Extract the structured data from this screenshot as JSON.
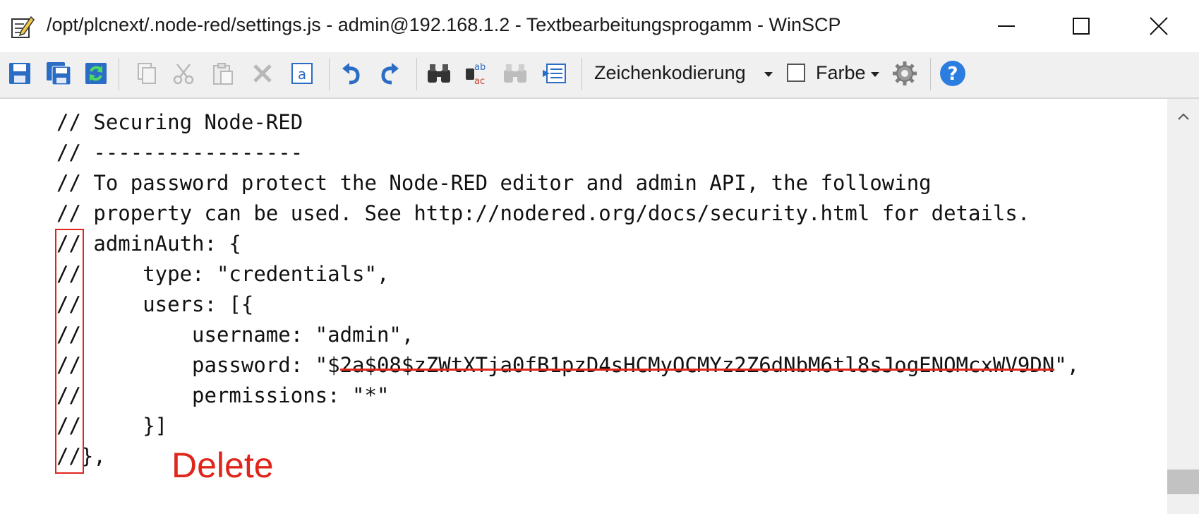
{
  "window": {
    "title": "/opt/plcnext/.node-red/settings.js - admin@192.168.1.2 - Textbearbeitungsprogamm - WinSCP"
  },
  "toolbar": {
    "encoding_label": "Zeichenkodierung",
    "color_label": "Farbe",
    "color_checked": false
  },
  "editor": {
    "lines": [
      "// Securing Node-RED",
      "// -----------------",
      "// To password protect the Node-RED editor and admin API, the following",
      "// property can be used. See http://nodered.org/docs/security.html for details.",
      "// adminAuth: {",
      "//     type: \"credentials\",",
      "//     users: [{",
      "//         username: \"admin\",",
      "//         password: \"$",
      "//         permissions: \"*\"",
      "//     }]",
      "//},"
    ],
    "password_struck": "2a$08$zZWtXTja0fB1pzD4sHCMyOCMYz2Z6dNbM6tl8sJogENOMcxWV9DN",
    "password_tail": "\","
  },
  "annotation": {
    "label": "Delete",
    "color": "#e0261b"
  }
}
